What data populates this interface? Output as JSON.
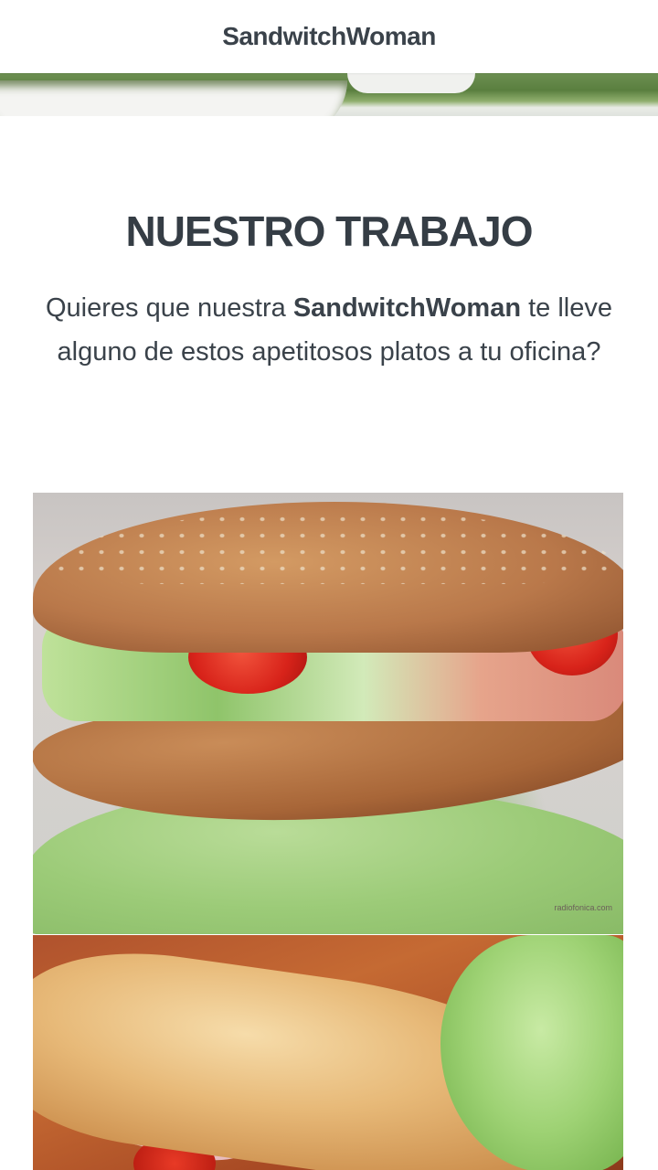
{
  "navbar": {
    "brand": "SandwitchWoman"
  },
  "section": {
    "title": "NUESTRO TRABAJO",
    "desc_before": "Quieres que nuestra ",
    "desc_bold": "SandwitchWoman",
    "desc_after": " te lleve alguno de estos apetitosos platos a tu oficina?"
  },
  "gallery": {
    "photo_1_watermark": "radiofonica.com"
  }
}
